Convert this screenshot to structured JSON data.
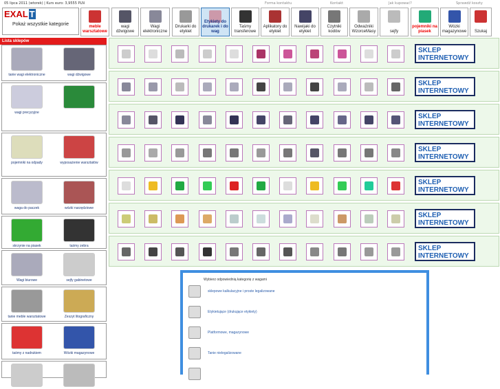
{
  "topbar": {
    "date": "05 lipca 2011 (wtorek) | Kurs euro: 3,9555 PLN",
    "links": [
      "Forma kontaktu",
      "Kontakt",
      "Jak kupować?",
      "Sprawdź koszty"
    ]
  },
  "logo": {
    "brand": "EXAL",
    "brand_mark": "T",
    "tagline": "Pokaż wszystkie kategorie"
  },
  "nav": {
    "items": [
      {
        "label": "meble warsztatowe",
        "icon": "workbench-icon",
        "color": "#c33",
        "style": "red"
      },
      {
        "label": "wagi dźwigowe",
        "icon": "crane-scale-icon",
        "color": "#556"
      },
      {
        "label": "Wagi elektroniczne",
        "icon": "scale-icon",
        "color": "#889"
      },
      {
        "label": "Drukarki do etykiet",
        "icon": "label-printer-icon",
        "color": "#999"
      },
      {
        "label": "Etykiety do drukarek i do wag",
        "icon": "labels-icon",
        "color": "#c9a",
        "active": true
      },
      {
        "label": "Taśmy transferowe",
        "icon": "ribbon-icon",
        "color": "#333"
      },
      {
        "label": "Aplikatory do etykiet",
        "icon": "applicator-icon",
        "color": "#a33"
      },
      {
        "label": "Nawijaki do etykiet",
        "icon": "rewinder-icon",
        "color": "#446"
      },
      {
        "label": "Czytniki kodów",
        "icon": "barcode-reader-icon",
        "color": "#777"
      },
      {
        "label": "Odważniki WzorceMasy",
        "icon": "weights-icon",
        "color": "#aaa"
      },
      {
        "label": "sejfy",
        "icon": "safe-icon",
        "color": "#bbb"
      },
      {
        "label": "pojemniki na piasek",
        "icon": "containers-icon",
        "color": "#2a7",
        "style": "red"
      },
      {
        "label": "Wózki magazynowe",
        "icon": "trolley-icon",
        "color": "#35a"
      },
      {
        "label": "Szukaj",
        "icon": "search-icon",
        "color": "#c33"
      }
    ]
  },
  "sidebar": {
    "title": "Lista sklepów",
    "cells": [
      [
        {
          "label": "tanie wagi elektroniczne",
          "color": "#aab"
        },
        {
          "label": "wagi dźwigowe",
          "color": "#667"
        }
      ],
      [
        {
          "label": "wagi precyzyjne",
          "color": "#ccd"
        },
        {
          "label": "",
          "color": "#2a8a3a"
        }
      ],
      [
        {
          "label": "pojemniki na odpady",
          "color": "#ddb"
        },
        {
          "label": "wyposażenie warsztatów",
          "color": "#c44"
        }
      ],
      [
        {
          "label": "waga do paczek",
          "color": "#bbc"
        },
        {
          "label": "wózki narzędziowe",
          "color": "#a55"
        }
      ],
      [
        {
          "label": "skrzynie na piasek",
          "color": "#3a3"
        },
        {
          "label": "taśmy zebra",
          "color": "#333"
        }
      ],
      [
        {
          "label": "Wagi biurowe",
          "color": "#aab"
        },
        {
          "label": "sejfy gabinetowe",
          "color": "#ccc"
        }
      ],
      [
        {
          "label": "tanie meble warsztatowe",
          "color": "#999"
        },
        {
          "label": "Zeszyt litograficzny",
          "color": "#ca5"
        }
      ],
      [
        {
          "label": "taśmy z nadrukiem",
          "color": "#d33"
        },
        {
          "label": "Wózki magazynowe",
          "color": "#35a"
        }
      ],
      [
        {
          "label": "",
          "color": "#ccc"
        },
        {
          "label": "",
          "color": "#bbb"
        }
      ]
    ]
  },
  "shop_label": "SKLEP INTERNETOWY",
  "rows": [
    {
      "colors": [
        "#ccc",
        "#ddd",
        "#bbb",
        "#ccc",
        "#ddd",
        "#a36",
        "#c59",
        "#b47",
        "#c59",
        "#ddd",
        "#ccc"
      ]
    },
    {
      "colors": [
        "#889",
        "#99a",
        "#bbb",
        "#aab",
        "#aab",
        "#444",
        "#aab",
        "#444",
        "#aab",
        "#bbb",
        "#666"
      ]
    },
    {
      "colors": [
        "#889",
        "#556",
        "#335",
        "#889",
        "#335",
        "#446",
        "#667",
        "#446",
        "#668",
        "#446",
        "#557"
      ]
    },
    {
      "colors": [
        "#999",
        "#aaa",
        "#999",
        "#777",
        "#777",
        "#999",
        "#777",
        "#556",
        "#777",
        "#777",
        "#888"
      ]
    },
    {
      "colors": [
        "#ddd",
        "#eb2",
        "#2a4",
        "#3c5",
        "#d22",
        "#2a4",
        "#ddd",
        "#eb2",
        "#3c5",
        "#2c9",
        "#d33"
      ]
    },
    {
      "colors": [
        "#cc7",
        "#cb6",
        "#d95",
        "#da6",
        "#bcc",
        "#cdd",
        "#aac",
        "#ddc",
        "#c96",
        "#bcb",
        "#cca"
      ]
    },
    {
      "colors": [
        "#666",
        "#444",
        "#555",
        "#333",
        "#777",
        "#666",
        "#555",
        "#888",
        "#777",
        "#999",
        "#999"
      ]
    }
  ],
  "category_box": {
    "heading": "Wybierz odpowiednią kategorię z wagami",
    "items": [
      {
        "label": "sklepowe kalkulacyjne i proste legalizowane",
        "icon": "shop-scale-icon"
      },
      {
        "label": "Etykietujące (drukujące etykiety)",
        "icon": "label-scale-icon"
      },
      {
        "label": "Platformowe, magazynowe",
        "icon": "platform-scale-icon"
      },
      {
        "label": "Tanie nielegalizowane",
        "icon": "cheap-scale-icon"
      },
      {
        "label": "",
        "icon": "scale-icon"
      }
    ]
  }
}
